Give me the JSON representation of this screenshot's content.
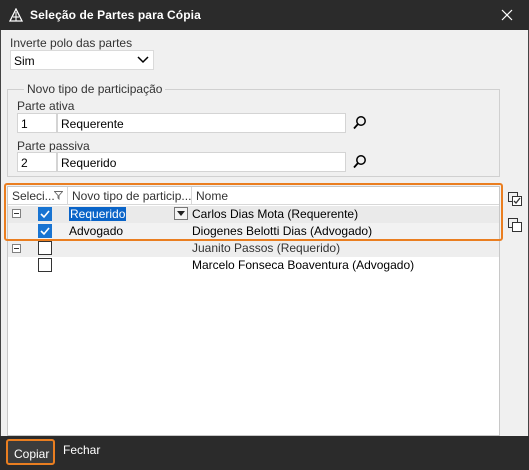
{
  "window": {
    "title": "Seleção de Partes para Cópia"
  },
  "invert": {
    "label": "Inverte polo das partes",
    "value": "Sim"
  },
  "group": {
    "title": "Novo tipo de participação",
    "parte_ativa": {
      "label": "Parte ativa",
      "code": "1",
      "text": "Requerente"
    },
    "parte_passiva": {
      "label": "Parte passiva",
      "code": "2",
      "text": "Requerido"
    }
  },
  "grid": {
    "columns": [
      "Seleci...",
      "Novo tipo de particip...",
      "Nome"
    ],
    "rows": [
      {
        "group": true,
        "checked": true,
        "tipo": "Requerido",
        "nome": "Carlos Dias Mota (Requerente)"
      },
      {
        "group": false,
        "checked": true,
        "tipo": "Advogado",
        "nome": "Diogenes Belotti Dias (Advogado)"
      },
      {
        "group": true,
        "checked": false,
        "tipo": "",
        "nome": "Juanito Passos (Requerido)"
      },
      {
        "group": false,
        "checked": false,
        "tipo": "",
        "nome": "Marcelo Fonseca Boaventura (Advogado)"
      }
    ]
  },
  "buttons": {
    "copiar": "Copiar",
    "fechar": "Fechar"
  },
  "colors": {
    "accent": "#ea7e20",
    "selection": "#0a64c8",
    "checkbox": "#1874d2",
    "bar": "#2b2b2b"
  }
}
